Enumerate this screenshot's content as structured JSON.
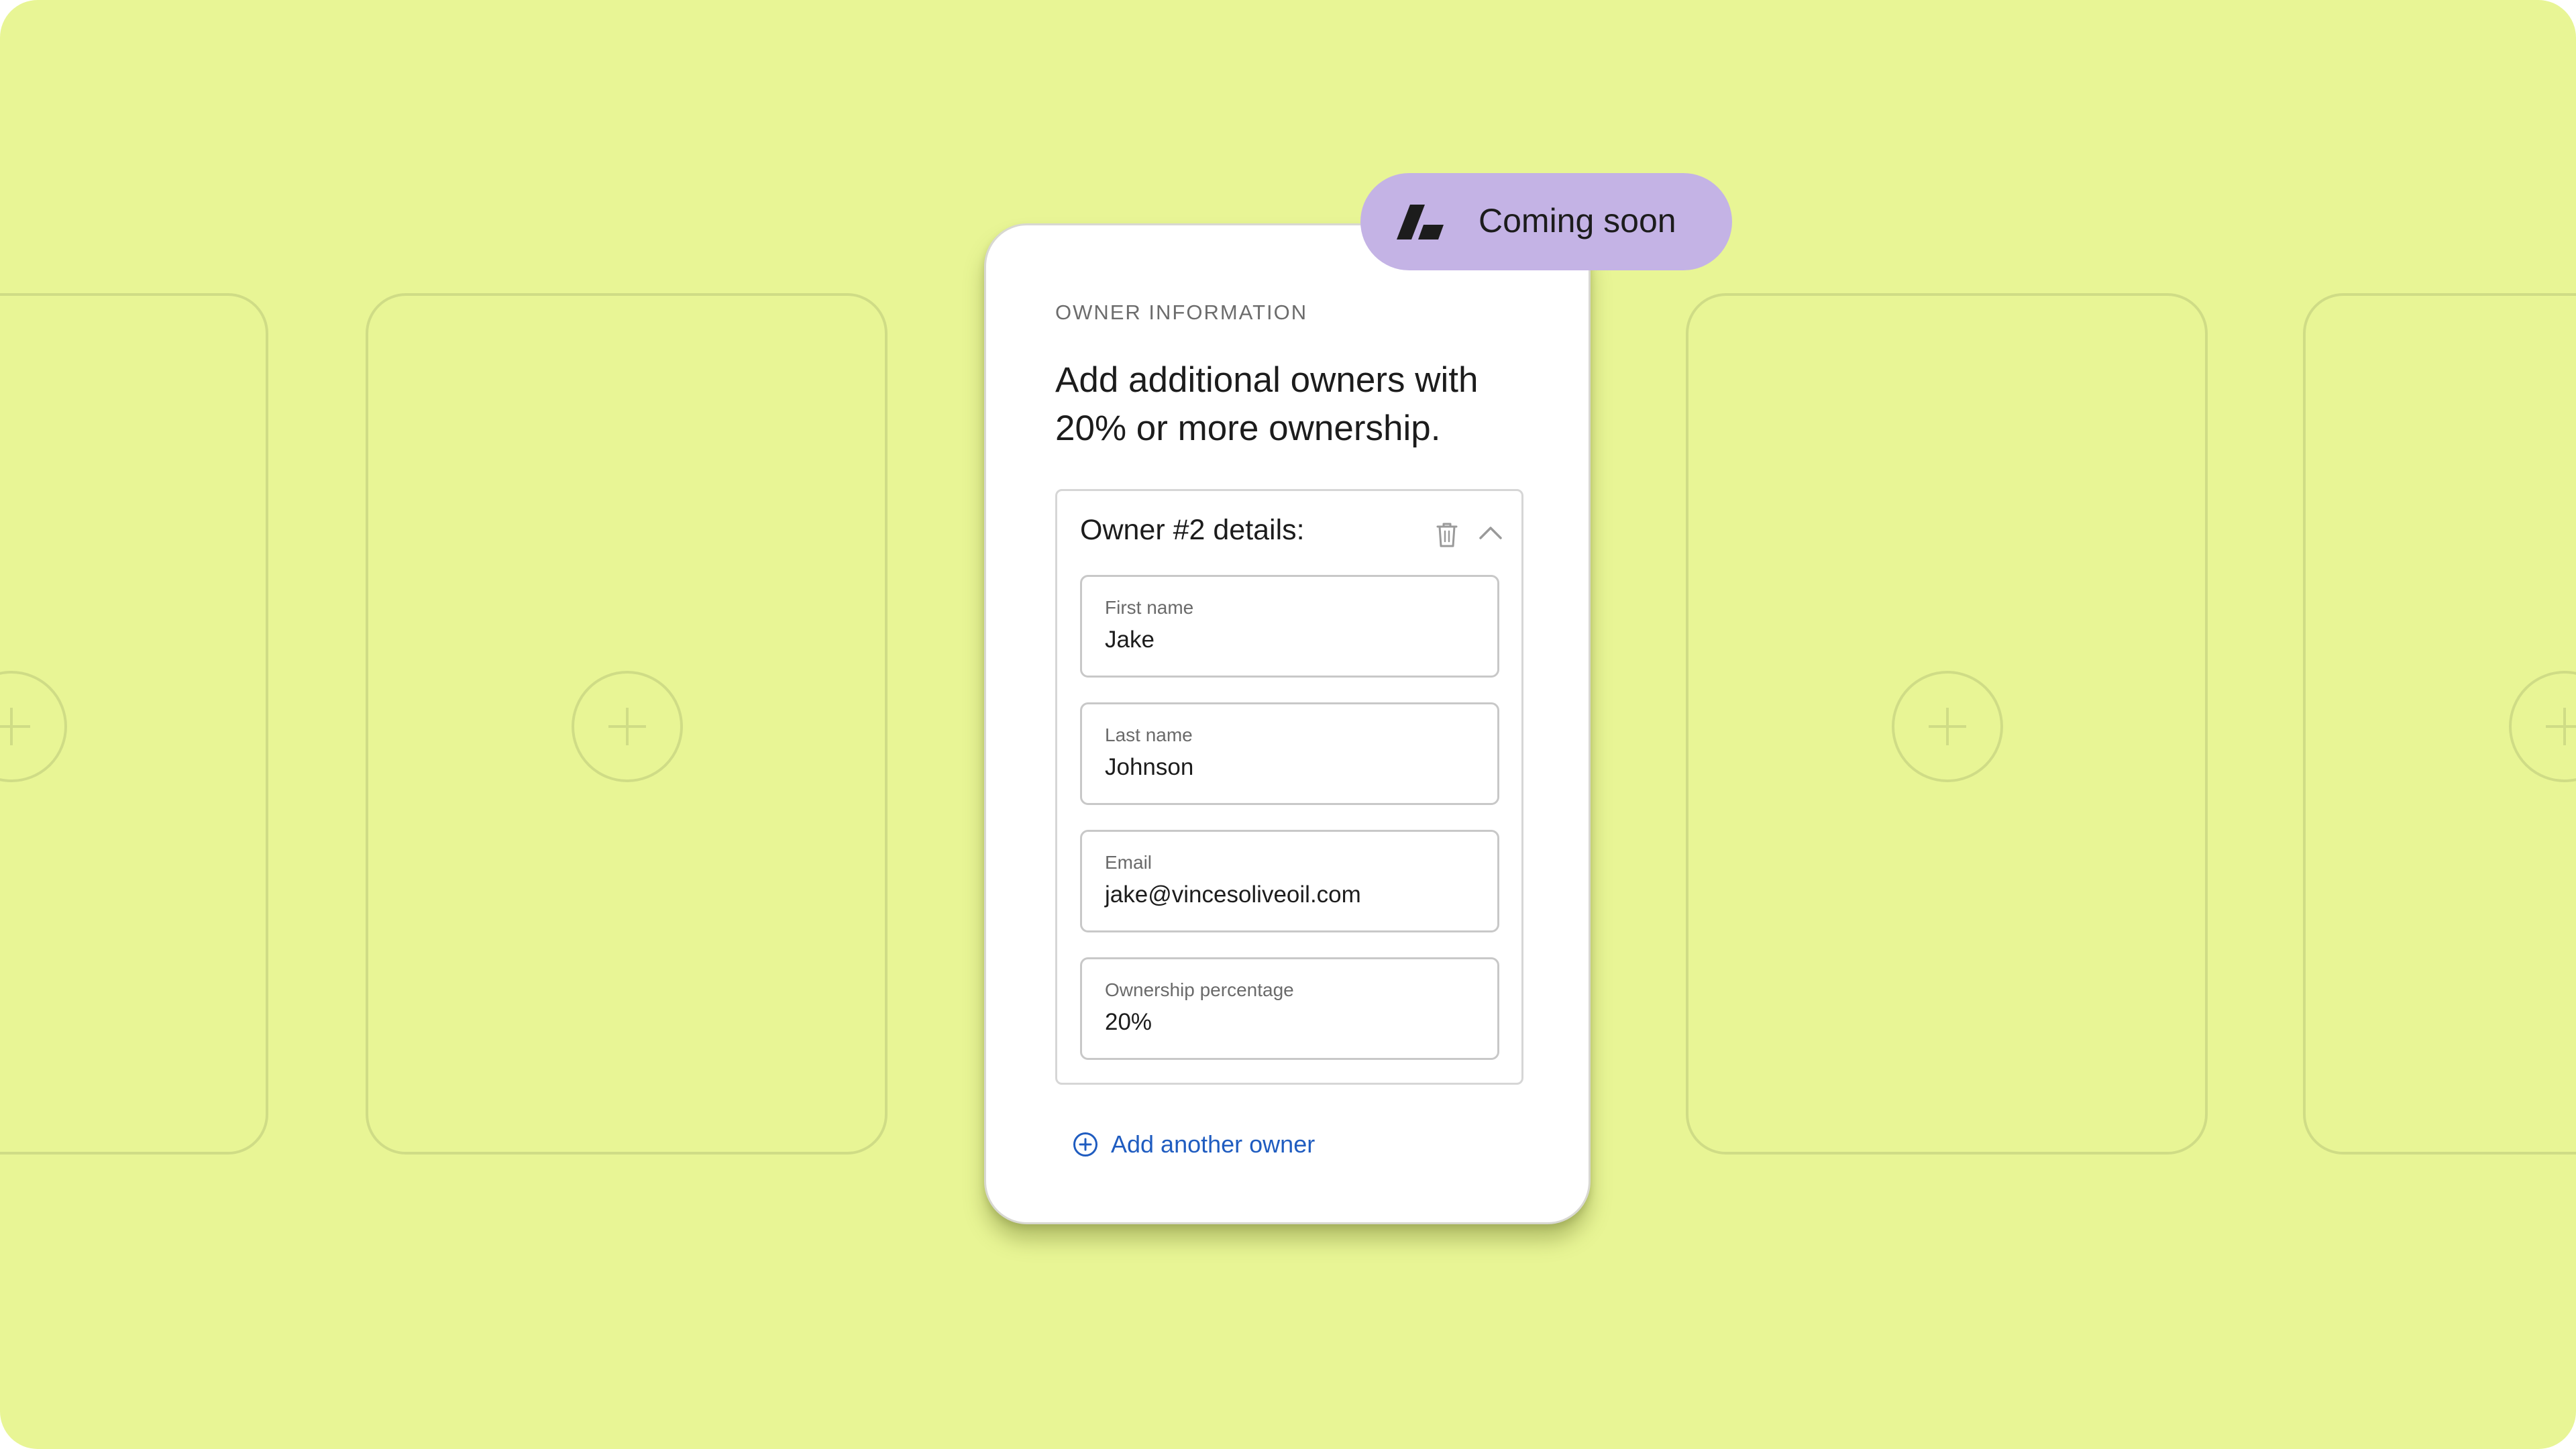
{
  "colors": {
    "background": "#e8f595",
    "placeholder_stroke": "#cfdc86",
    "badge": "#c4b3e5",
    "link": "#1f5cc0"
  },
  "badge": {
    "label": "Coming soon",
    "logo_icon": "brand-logo-icon"
  },
  "form": {
    "section_label": "OWNER INFORMATION",
    "heading": "Add additional owners with 20% or more ownership.",
    "owner_card": {
      "title": "Owner #2 details:",
      "delete_icon": "trash-icon",
      "collapse_icon": "chevron-up-icon",
      "fields": [
        {
          "label": "First name",
          "value": "Jake"
        },
        {
          "label": "Last name",
          "value": "Johnson"
        },
        {
          "label": "Email",
          "value": "jake@vincesoliveoil.com"
        },
        {
          "label": "Ownership percentage",
          "value": "20%"
        }
      ]
    },
    "add_owner_label": "Add another owner",
    "add_owner_icon": "plus-circle-icon"
  },
  "placeholders": {
    "add_icon": "plus-circle-icon"
  }
}
